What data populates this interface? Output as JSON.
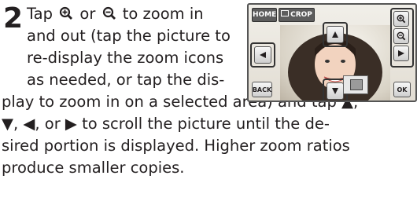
{
  "step": {
    "number": "2",
    "lines": [
      "Tap ⊕ or ⊖ to zoom in",
      "and out (tap the picture to",
      "re-display the zoom icons",
      "as needed, or tap the dis-",
      "play to zoom in on a selected area) and tap ▲,",
      "▼, ◀, or ▶ to scroll the picture until the de-",
      "sired portion is displayed. Higher zoom ratios",
      "produce smaller copies."
    ]
  },
  "screen": {
    "home_label": "HOME",
    "crop_label": "CROP",
    "back_label": "BACK",
    "ok_label": "OK"
  },
  "icons": {
    "zoom_in": "zoom-in-icon",
    "zoom_out": "zoom-out-icon",
    "up": "arrow-up-icon",
    "down": "arrow-down-icon",
    "left": "arrow-left-icon",
    "right": "arrow-right-icon"
  },
  "colors": {
    "text": "#231f20",
    "screen_border": "#555555",
    "callout": "#333333"
  }
}
